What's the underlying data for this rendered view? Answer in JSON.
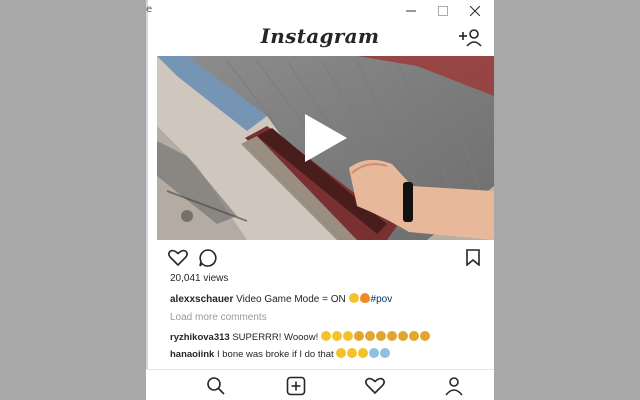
{
  "window": {
    "mark": "e"
  },
  "app": {
    "title": "Instagram"
  },
  "post": {
    "views": "20,041 views",
    "caption_user": "alexxschauer",
    "caption_text": " Video Game Mode = ON ",
    "caption_tag": "#pov",
    "load_more": "Load more comments",
    "comments": [
      {
        "user": "ryzhikova313",
        "text": " SUPERRR! Wooow! "
      },
      {
        "user": "hanaoiink",
        "text": " I bone was broke if I do that "
      },
      {
        "user": "",
        "text": ""
      }
    ]
  },
  "colors": {
    "accent_link": "#003569",
    "text_primary": "#262626",
    "text_muted": "#999999",
    "emoji_yellow": "#f4c22b"
  },
  "icons": {
    "minimize": "minimize-icon",
    "maximize": "maximize-icon",
    "close": "close-icon",
    "add_user": "add-user-icon",
    "like": "heart-icon",
    "comment": "comment-icon",
    "save": "bookmark-icon",
    "play": "play-icon",
    "search": "search-icon",
    "new_post": "plus-square-icon",
    "activity": "heart-icon",
    "profile": "profile-icon"
  }
}
